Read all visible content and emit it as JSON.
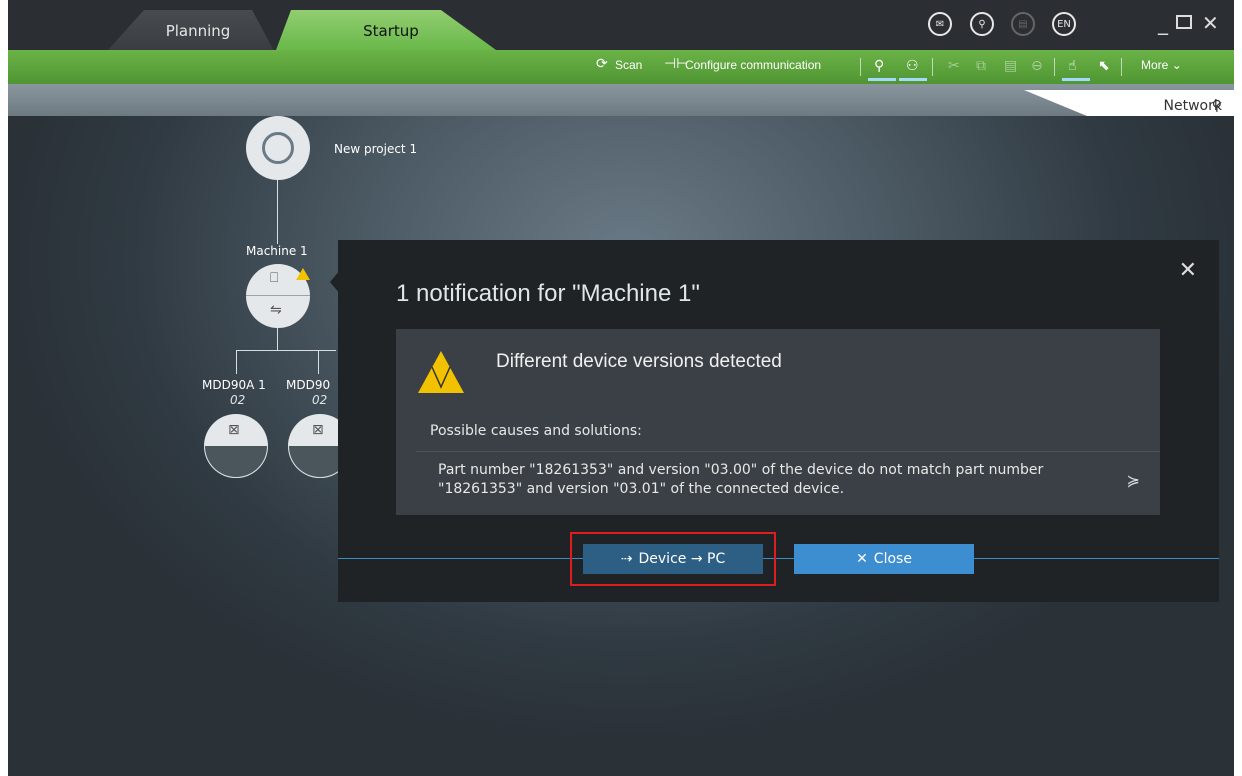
{
  "tabs": [
    {
      "label": "Planning"
    },
    {
      "label": "Startup"
    }
  ],
  "title_icons": [
    "message-icon",
    "binoculars-icon",
    "document-icon",
    "EN"
  ],
  "toolbar": {
    "scan": "Scan",
    "configure": "Configure communication",
    "more": "More"
  },
  "view_tab": {
    "label": "Network"
  },
  "tree": {
    "project": "New project 1",
    "machine": "Machine 1",
    "devices": [
      {
        "name": "MDD90A 1",
        "sub": "02"
      },
      {
        "name": "MDD90",
        "sub": "02"
      }
    ]
  },
  "dialog": {
    "title": "1 notification for \"Machine 1\"",
    "notification_title": "Different device versions detected",
    "causes_label": "Possible causes and solutions:",
    "detail": "Part number \"18261353\" and version \"03.00\" of the device do not match part number \"18261353\" and version \"03.01\" of the connected device.",
    "btn_device": "Device → PC",
    "btn_close": "Close"
  }
}
